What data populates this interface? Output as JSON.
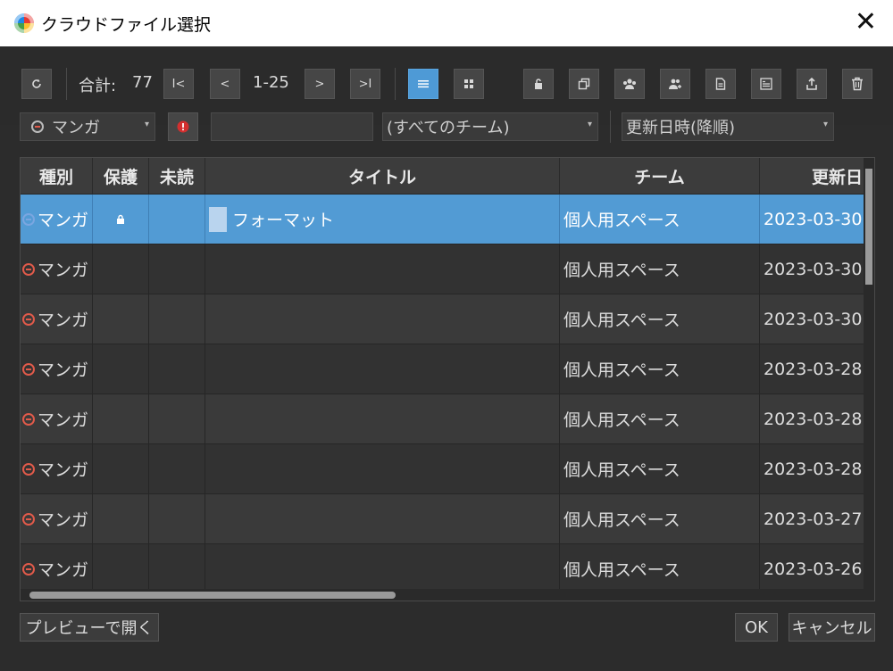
{
  "window": {
    "title": "クラウドファイル選択",
    "close_glyph": "✕"
  },
  "toolbar": {
    "total_label": "合計:",
    "total_count": "77",
    "page_range": "1-25",
    "first_glyph": "I<",
    "prev_glyph": "<",
    "next_glyph": ">",
    "last_glyph": ">I"
  },
  "filters": {
    "type": "マンガ",
    "search_value": "",
    "team": "(すべてのチーム)",
    "sort": "更新日時(降順)"
  },
  "table": {
    "columns": [
      "種別",
      "保護",
      "未読",
      "タイトル",
      "チーム",
      "更新日"
    ],
    "rows": [
      {
        "type": "マンガ",
        "locked": true,
        "unread": "",
        "title": "フォーマット",
        "team": "個人用スペース",
        "updated": "2023-03-30"
      },
      {
        "type": "マンガ",
        "locked": false,
        "unread": "",
        "title": "",
        "team": "個人用スペース",
        "updated": "2023-03-30"
      },
      {
        "type": "マンガ",
        "locked": false,
        "unread": "",
        "title": "",
        "team": "個人用スペース",
        "updated": "2023-03-30"
      },
      {
        "type": "マンガ",
        "locked": false,
        "unread": "",
        "title": "",
        "team": "個人用スペース",
        "updated": "2023-03-28"
      },
      {
        "type": "マンガ",
        "locked": false,
        "unread": "",
        "title": "",
        "team": "個人用スペース",
        "updated": "2023-03-28"
      },
      {
        "type": "マンガ",
        "locked": false,
        "unread": "",
        "title": "",
        "team": "個人用スペース",
        "updated": "2023-03-28"
      },
      {
        "type": "マンガ",
        "locked": false,
        "unread": "",
        "title": "",
        "team": "個人用スペース",
        "updated": "2023-03-27"
      },
      {
        "type": "マンガ",
        "locked": false,
        "unread": "",
        "title": "",
        "team": "個人用スペース",
        "updated": "2023-03-26"
      }
    ]
  },
  "footer": {
    "preview_label": "プレビューで開く",
    "ok_label": "OK",
    "cancel_label": "キャンセル"
  },
  "colors": {
    "accent": "#529bd4",
    "manga_icon": "#e05a4a",
    "warning": "#d32f2f"
  }
}
